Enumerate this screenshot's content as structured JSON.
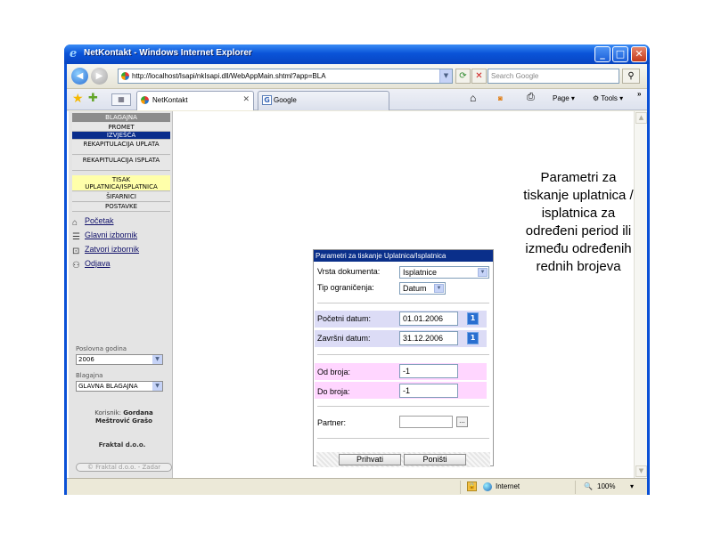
{
  "window": {
    "title": "NetKontakt - Windows Internet Explorer",
    "min_glyph": "_",
    "max_glyph": "□",
    "close_glyph": "✕"
  },
  "addressbar": {
    "url": "http://localhost/Isapi/nkIsapi.dll/WebAppMain.shtml?app=BLA",
    "search_placeholder": "Search Google"
  },
  "tabs": [
    {
      "label": "NetKontakt"
    },
    {
      "label": "Google"
    }
  ],
  "commandbar": {
    "page_label": "Page",
    "tools_label": "Tools"
  },
  "sidebar": {
    "header": "BLAGAJNA",
    "menu": [
      {
        "label": "PROMET"
      },
      {
        "label": "IZVJEŠĆA"
      },
      {
        "label": "REKAPITULACIJA UPLATA"
      },
      {
        "label": "REKAPITULACIJA ISPLATA"
      },
      {
        "label": "TISAK UPLATNICA/ISPLATNICA"
      },
      {
        "label": "ŠIFARNICI"
      },
      {
        "label": "POSTAVKE"
      }
    ],
    "links": [
      {
        "label": "Početak"
      },
      {
        "label": "Glavni izbornik"
      },
      {
        "label": "Zatvori izbornik"
      },
      {
        "label": "Odjava"
      }
    ],
    "year_label": "Poslovna godina",
    "year_value": "2006",
    "cash_label": "Blagajna",
    "cash_value": "GLAVNA BLAGAJNA",
    "user_prefix": "Korisnik:",
    "user_name": "Gordana Meštrović Grašo",
    "company": "Fraktal d.o.o.",
    "copyright": "© Fraktal d.o.o. - Zadar"
  },
  "dialog": {
    "title": "Parametri za tiskanje Uplatnica/Isplatnica",
    "doc_type_label": "Vrsta dokumenta:",
    "doc_type_value": "Isplatnice",
    "limit_type_label": "Tip ograničenja:",
    "limit_type_value": "Datum",
    "start_date_label": "Početni datum:",
    "start_date_value": "01.01.2006",
    "end_date_label": "Završni datum:",
    "end_date_value": "31.12.2006",
    "from_no_label": "Od broja:",
    "from_no_value": "-1",
    "to_no_label": "Do broja:",
    "to_no_value": "-1",
    "partner_label": "Partner:",
    "partner_value": "",
    "partner_btn": "...",
    "confirm_btn": "Prihvati",
    "cancel_btn": "Poništi"
  },
  "statusbar": {
    "zone": "Internet",
    "zoom": "100%"
  },
  "callout": {
    "text": "Parametri za tiskanje uplatnica / isplatnica za određeni period ili između određenih rednih brojeva",
    "fill": "#a6caf0"
  }
}
